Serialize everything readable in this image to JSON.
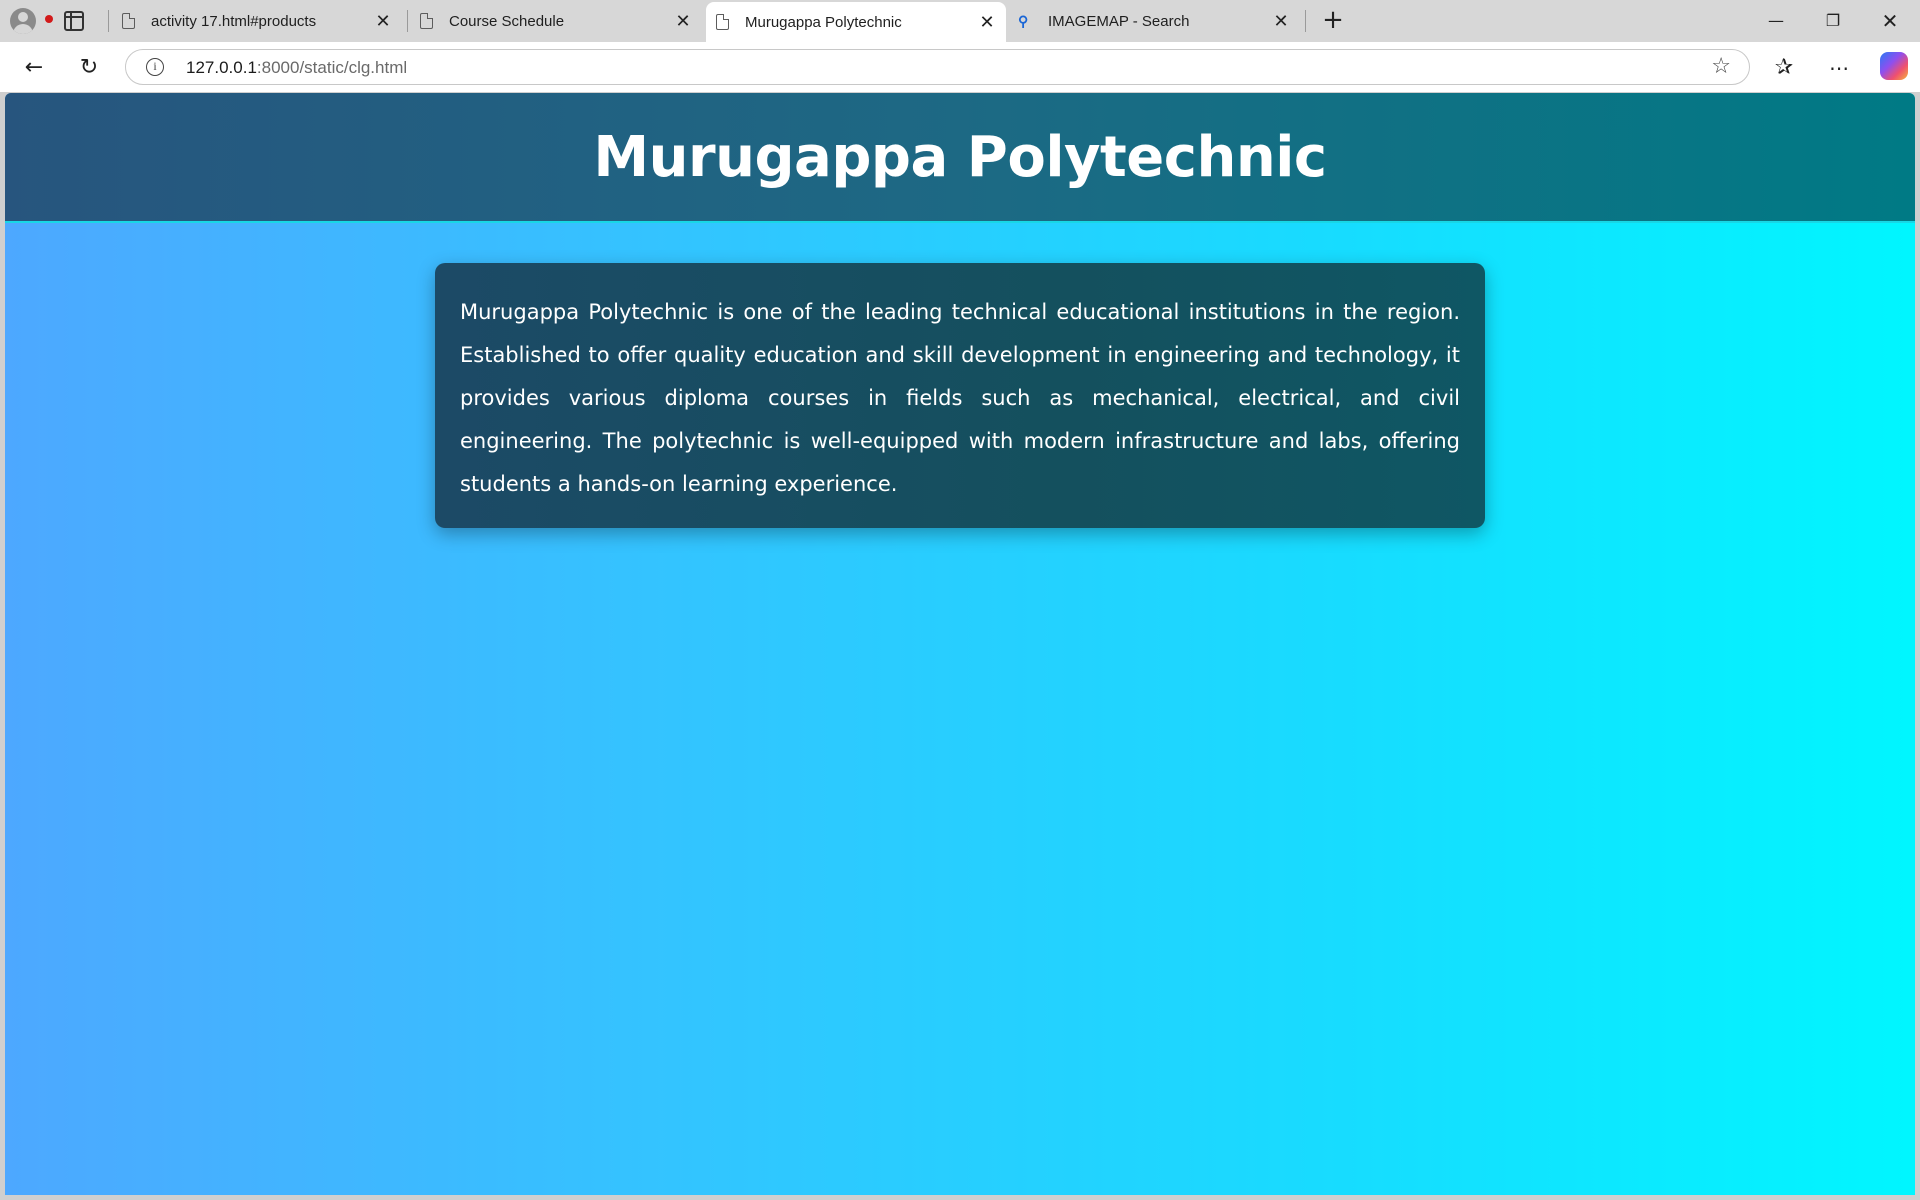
{
  "browser": {
    "tabs": [
      {
        "label": "activity 17.html#products",
        "icon": "document-icon",
        "active": false
      },
      {
        "label": "Course Schedule",
        "icon": "document-icon",
        "active": false
      },
      {
        "label": "Murugappa Polytechnic",
        "icon": "document-icon",
        "active": true
      },
      {
        "label": "IMAGEMAP - Search",
        "icon": "search-icon",
        "active": false
      }
    ],
    "address": {
      "host": "127.0.0.1",
      "path": ":8000/static/clg.html"
    },
    "accent_color": "#d21a1a"
  },
  "page": {
    "title": "Murugappa Polytechnic",
    "about": "Murugappa Polytechnic is one of the leading technical educational institutions in the region. Established to offer quality education and skill development in engineering and technology, it provides various diploma courses in fields such as mechanical, electrical, and civil engineering. The polytechnic is well-equipped with modern infrastructure and labs, offering students a hands-on learning experience.",
    "colors": {
      "header_start": "#27557e",
      "header_end": "#007a85",
      "background_start": "#4da8ff",
      "background_end": "#00f6ff",
      "card": "#14505e"
    }
  }
}
